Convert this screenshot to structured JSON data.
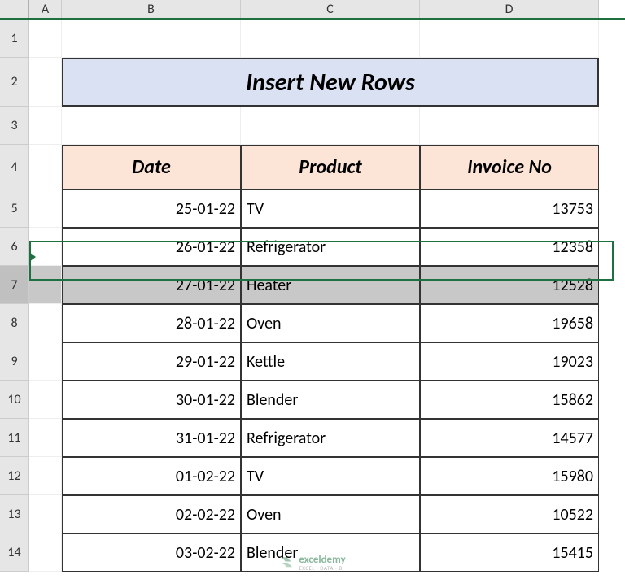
{
  "columns": [
    "A",
    "B",
    "C",
    "D"
  ],
  "rowNumbers": [
    "1",
    "2",
    "3",
    "4",
    "5",
    "6",
    "7",
    "8",
    "9",
    "10",
    "11",
    "12",
    "13",
    "14"
  ],
  "title": "Insert New Rows",
  "headers": {
    "date": "Date",
    "product": "Product",
    "invoice": "Invoice No"
  },
  "rows": [
    {
      "date": "25-01-22",
      "product": "TV",
      "invoice": "13753"
    },
    {
      "date": "26-01-22",
      "product": "Refrigerator",
      "invoice": "12358"
    },
    {
      "date": "27-01-22",
      "product": "Heater",
      "invoice": "12528"
    },
    {
      "date": "28-01-22",
      "product": "Oven",
      "invoice": "19658"
    },
    {
      "date": "29-01-22",
      "product": "Kettle",
      "invoice": "19023"
    },
    {
      "date": "30-01-22",
      "product": "Blender",
      "invoice": "15862"
    },
    {
      "date": "31-01-22",
      "product": "Refrigerator",
      "invoice": "14577"
    },
    {
      "date": "01-02-22",
      "product": "TV",
      "invoice": "15980"
    },
    {
      "date": "02-02-22",
      "product": "Oven",
      "invoice": "10522"
    },
    {
      "date": "03-02-22",
      "product": "Blender",
      "invoice": "15415"
    }
  ],
  "selectedRow": 7,
  "watermark": {
    "brand": "exceldemy",
    "tagline": "EXCEL · DATA · BI"
  }
}
